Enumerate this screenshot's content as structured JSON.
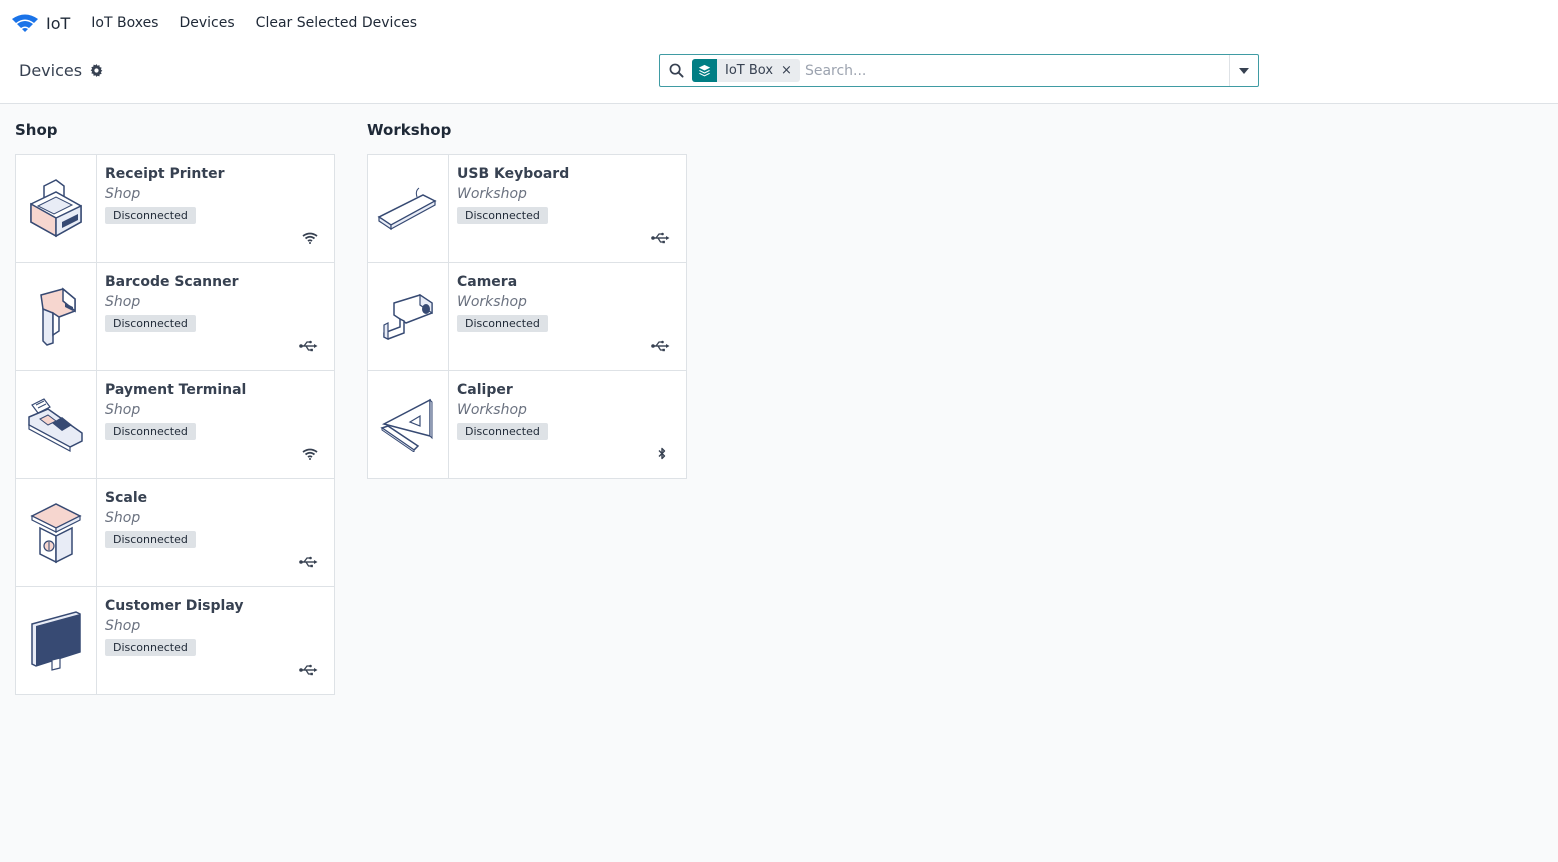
{
  "navbar": {
    "brand": "IoT",
    "items": [
      {
        "label": "IoT Boxes"
      },
      {
        "label": "Devices"
      },
      {
        "label": "Clear Selected Devices"
      }
    ]
  },
  "control_panel": {
    "title": "Devices",
    "search": {
      "facet_label": "IoT Box",
      "facet_remove": "×",
      "placeholder": "Search..."
    }
  },
  "groups": [
    {
      "title": "Shop",
      "cards": [
        {
          "name": "Receipt Printer",
          "location": "Shop",
          "status": "Disconnected",
          "connection": "wifi-icon",
          "image": "printer"
        },
        {
          "name": "Barcode Scanner",
          "location": "Shop",
          "status": "Disconnected",
          "connection": "usb-icon",
          "image": "scanner"
        },
        {
          "name": "Payment Terminal",
          "location": "Shop",
          "status": "Disconnected",
          "connection": "wifi-icon",
          "image": "terminal"
        },
        {
          "name": "Scale",
          "location": "Shop",
          "status": "Disconnected",
          "connection": "usb-icon",
          "image": "scale"
        },
        {
          "name": "Customer Display",
          "location": "Shop",
          "status": "Disconnected",
          "connection": "usb-icon",
          "image": "display"
        }
      ]
    },
    {
      "title": "Workshop",
      "cards": [
        {
          "name": "USB Keyboard",
          "location": "Workshop",
          "status": "Disconnected",
          "connection": "usb-icon",
          "image": "keyboard"
        },
        {
          "name": "Camera",
          "location": "Workshop",
          "status": "Disconnected",
          "connection": "usb-icon",
          "image": "camera"
        },
        {
          "name": "Caliper",
          "location": "Workshop",
          "status": "Disconnected",
          "connection": "bluetooth-icon",
          "image": "caliper"
        }
      ]
    }
  ],
  "colors": {
    "brand_blue": "#1a73e8",
    "teal": "#017e84",
    "search_border": "#3f9ba3",
    "badge_bg": "#dee2e6",
    "device_navy": "#374a73",
    "device_pink": "#f6d6cf"
  }
}
